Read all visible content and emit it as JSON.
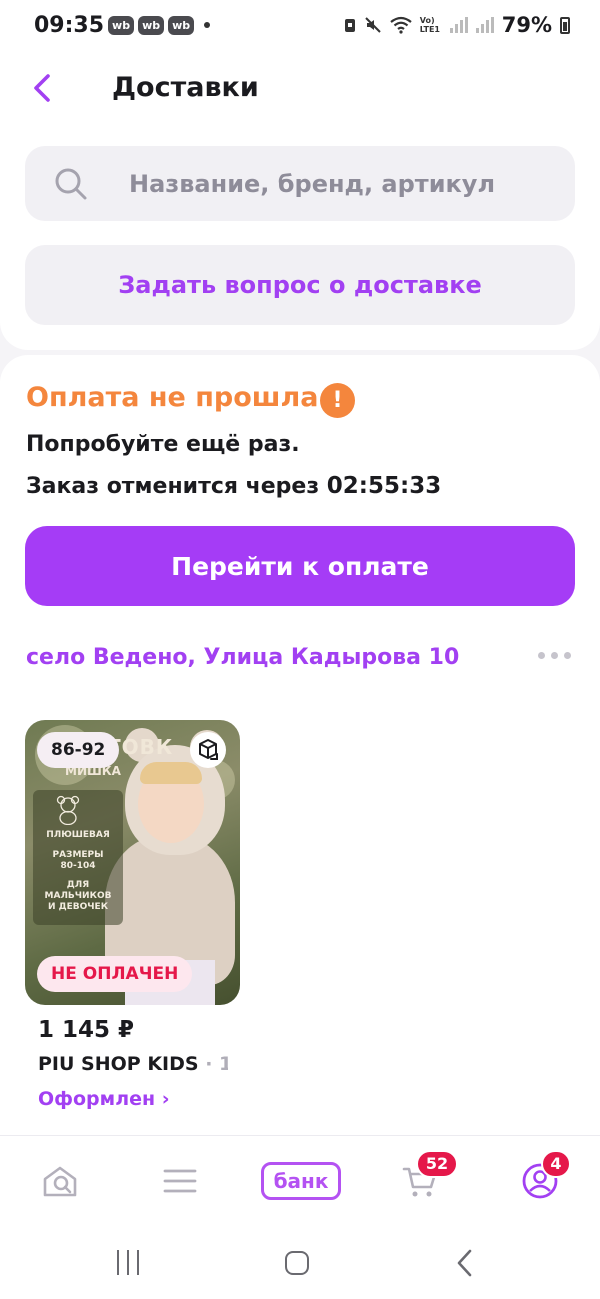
{
  "status_bar": {
    "time": "09:35",
    "app_badges": [
      "wb",
      "wb",
      "wb"
    ],
    "network": "Vo) LTE1",
    "battery": "79%"
  },
  "header": {
    "title": "Доставки",
    "back_icon": "chevron-left-icon"
  },
  "search": {
    "placeholder": "Название, бренд, артикул",
    "value": ""
  },
  "ask_button": {
    "label": "Задать вопрос о доставке"
  },
  "order": {
    "status_title": "Оплата не прошла",
    "message": "Попробуйте ещё раз.",
    "cancel_prefix": "Заказ отменится через ",
    "countdown": "02:55:33",
    "pay_button": "Перейти к оплате",
    "address": "село Ведено, Улица Кадырова 10",
    "colors": {
      "warning": "#f4863d",
      "accent": "#a53cf6",
      "error": "#e5184a"
    }
  },
  "product": {
    "image_text": {
      "headline": "ТОВК",
      "subline": "МИШКА",
      "texture": "ПЛЮШЕВАЯ",
      "sizes": "РАЗМЕРЫ\n80-104",
      "audience": "ДЛЯ\nМАЛЬЧИКОВ\nИ ДЕВОЧЕК"
    },
    "size_badge": "86-92",
    "status_badge": "НЕ ОПЛАЧЕН",
    "price": "1 145 ₽",
    "seller": "PIU SHOP KIDS",
    "seller_suffix": " · 1",
    "order_status": "Оформлен ›"
  },
  "tab_bar": {
    "bank_label": "банк",
    "cart_count": "52",
    "profile_count": "4"
  }
}
